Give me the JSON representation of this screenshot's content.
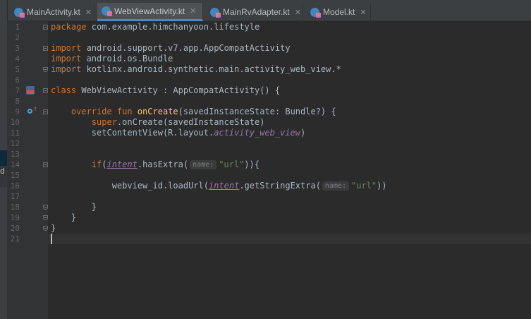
{
  "tabs": [
    {
      "label": "MainActivity.kt",
      "active": false
    },
    {
      "label": "WebViewActivity.kt",
      "active": true
    },
    {
      "label": "MainRvAdapter.kt",
      "active": false
    },
    {
      "label": "Model.kt",
      "active": false
    }
  ],
  "tab_close_glyph": "✕",
  "side_fragment": "d",
  "line_numbers": [
    "1",
    "2",
    "3",
    "4",
    "5",
    "6",
    "7",
    "8",
    "9",
    "10",
    "11",
    "12",
    "13",
    "14",
    "15",
    "16",
    "17",
    "18",
    "19",
    "20",
    "21"
  ],
  "code": {
    "l1_kw": "package",
    "l1_rest": " com.example.himchanyoon.lifestyle",
    "l3_kw": "import",
    "l3_rest": " android.support.v7.app.AppCompatActivity",
    "l4_kw": "import",
    "l4_rest": " android.os.Bundle",
    "l5_kw": "import",
    "l5_rest": " kotlinx.android.synthetic.main.activity_web_view.*",
    "l7_kw": "class",
    "l7_rest": " WebViewActivity : AppCompatActivity() {",
    "l9_indent": "    ",
    "l9_kw": "override fun",
    "l9_sp": " ",
    "l9_fn": "onCreate",
    "l9_rest": "(savedInstanceState: Bundle?) {",
    "l10_indent": "        ",
    "l10_kw": "super",
    "l10_rest": ".onCreate(savedInstanceState)",
    "l11_pre": "        setContentView(R.layout.",
    "l11_ext": "activity_web_view",
    "l11_post": ")",
    "l14_indent": "        ",
    "l14_kw": "if",
    "l14_paren": "(",
    "l14_intent": "intent",
    "l14_call": ".hasExtra(",
    "l14_hint": "name:",
    "l14_str": "\"url\"",
    "l14_post": ")){",
    "l16_pre": "            webview_id.loadUrl(",
    "l16_intent": "intent",
    "l16_call": ".getStringExtra(",
    "l16_hint": "name:",
    "l16_str": "\"url\"",
    "l16_post": "))",
    "l18": "        }",
    "l19": "    }",
    "l20": "}"
  },
  "colors": {
    "background": "#2b2b2b",
    "keyword": "#cc7832",
    "function": "#ffc66d",
    "string": "#6a8759",
    "synthetic": "#9876aa",
    "text": "#a9b7c6"
  },
  "icons": {
    "tab_file": "kotlin-file-icon",
    "gutter_line7": "run-activity-icon",
    "gutter_line9": "override-method-icon"
  }
}
